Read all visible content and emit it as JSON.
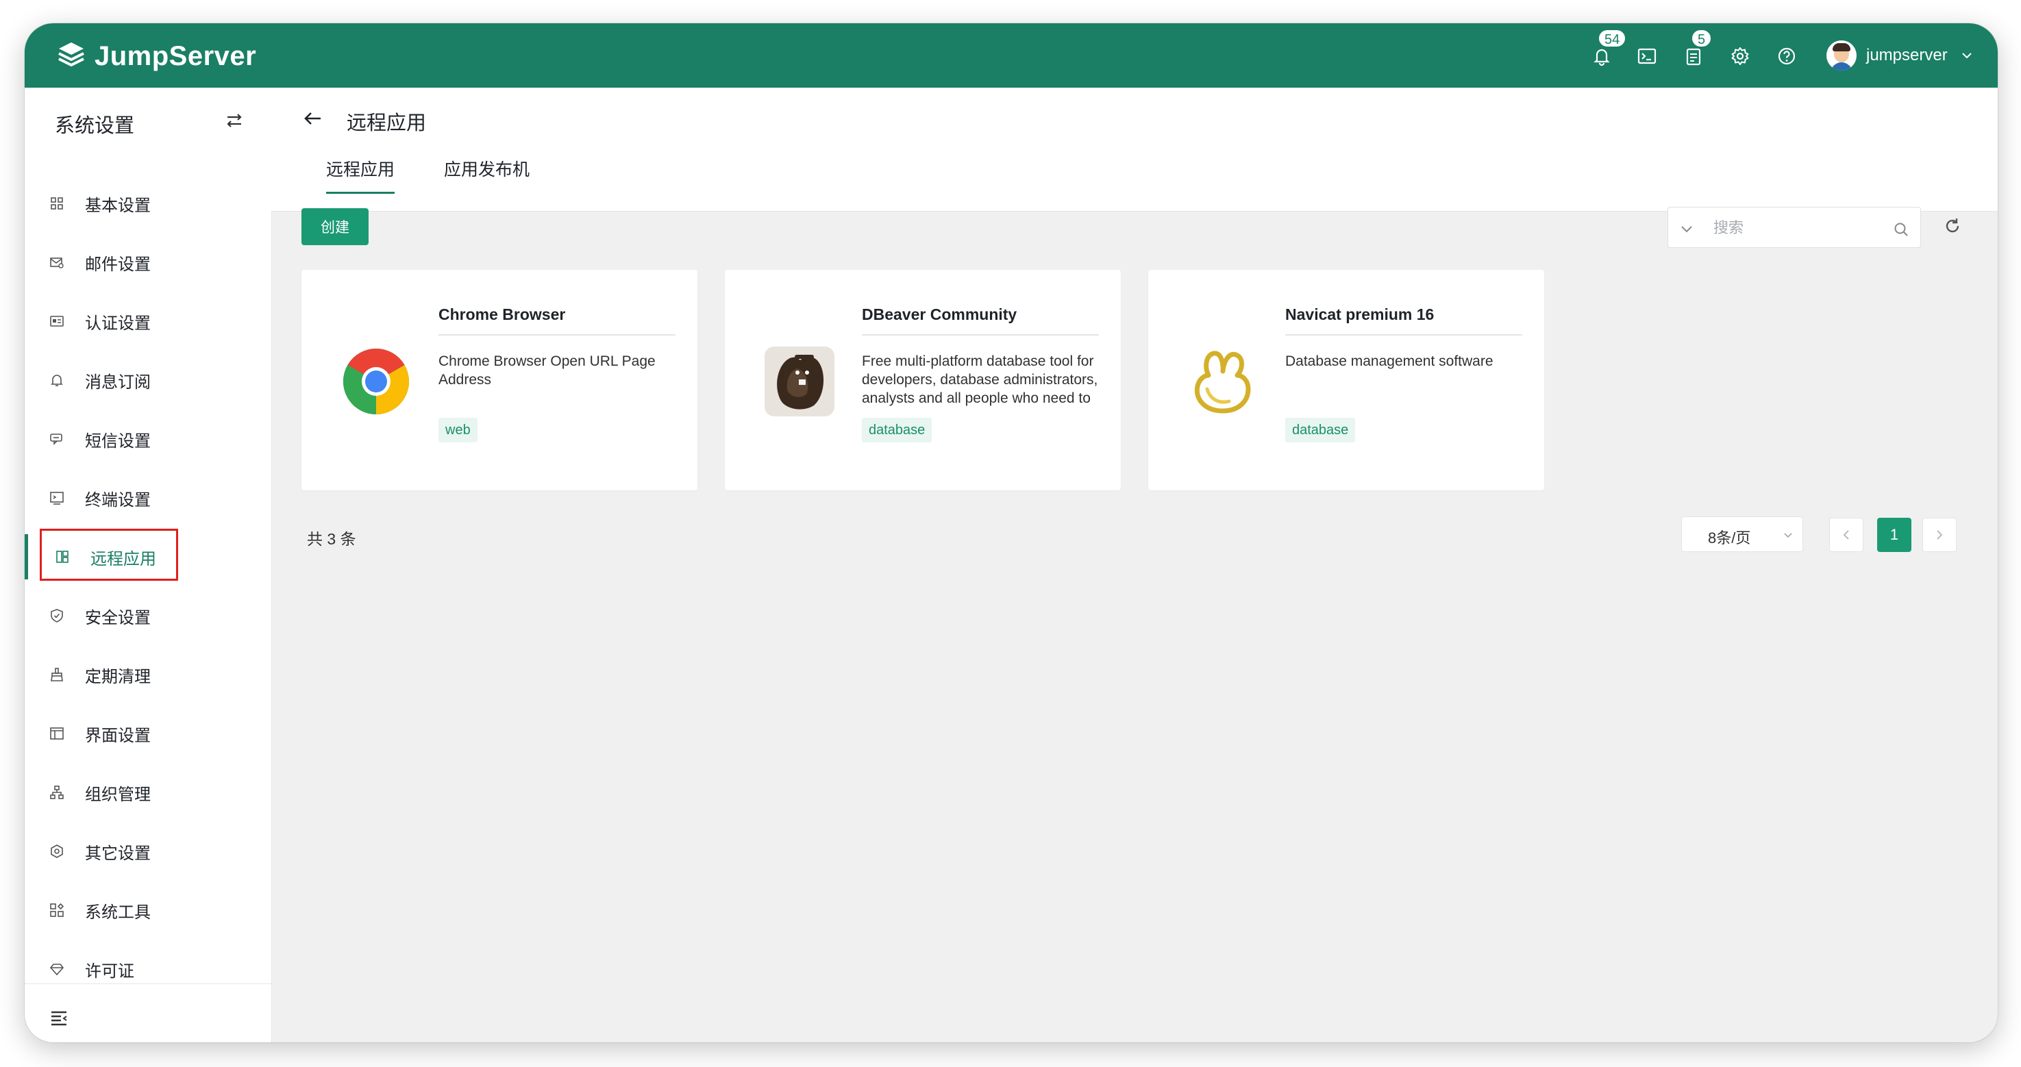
{
  "app": {
    "brand": "JumpServer",
    "accent_color": "#1a7f64",
    "header": {
      "notifications_badge": "54",
      "tickets_badge": "5",
      "icons": [
        "bell-icon",
        "terminal-icon",
        "clipboard-icon",
        "gear-icon",
        "help-icon"
      ],
      "username": "jumpserver"
    }
  },
  "sidebar": {
    "title": "系统设置",
    "items": [
      {
        "label": "基本设置",
        "icon": "grid-icon"
      },
      {
        "label": "邮件设置",
        "icon": "mail-icon"
      },
      {
        "label": "认证设置",
        "icon": "id-card-icon"
      },
      {
        "label": "消息订阅",
        "icon": "bell-icon"
      },
      {
        "label": "短信设置",
        "icon": "message-icon"
      },
      {
        "label": "终端设置",
        "icon": "terminal-icon"
      },
      {
        "label": "远程应用",
        "icon": "apps-icon",
        "active": true
      },
      {
        "label": "安全设置",
        "icon": "shield-icon"
      },
      {
        "label": "定期清理",
        "icon": "broom-icon"
      },
      {
        "label": "界面设置",
        "icon": "layout-icon"
      },
      {
        "label": "组织管理",
        "icon": "org-icon"
      },
      {
        "label": "其它设置",
        "icon": "hexagon-gear-icon"
      },
      {
        "label": "系统工具",
        "icon": "tools-icon"
      },
      {
        "label": "许可证",
        "icon": "diamond-icon"
      }
    ]
  },
  "page": {
    "title": "远程应用",
    "tabs": [
      {
        "label": "远程应用",
        "active": true
      },
      {
        "label": "应用发布机",
        "active": false
      }
    ],
    "create_label": "创建",
    "search_placeholder": "搜索"
  },
  "cards": [
    {
      "name": "Chrome Browser",
      "description": "Chrome Browser Open URL Page Address",
      "tag": "web",
      "logo": "chrome-logo"
    },
    {
      "name": "DBeaver Community",
      "description": "Free multi-platform database tool for developers, database administrators, analysts and all people who need to",
      "tag": "database",
      "logo": "dbeaver-logo"
    },
    {
      "name": "Navicat premium 16",
      "description": "Database management software",
      "tag": "database",
      "logo": "navicat-logo"
    }
  ],
  "pagination": {
    "total_text": "共 3 条",
    "page_size": "8条/页",
    "current_page": "1"
  }
}
